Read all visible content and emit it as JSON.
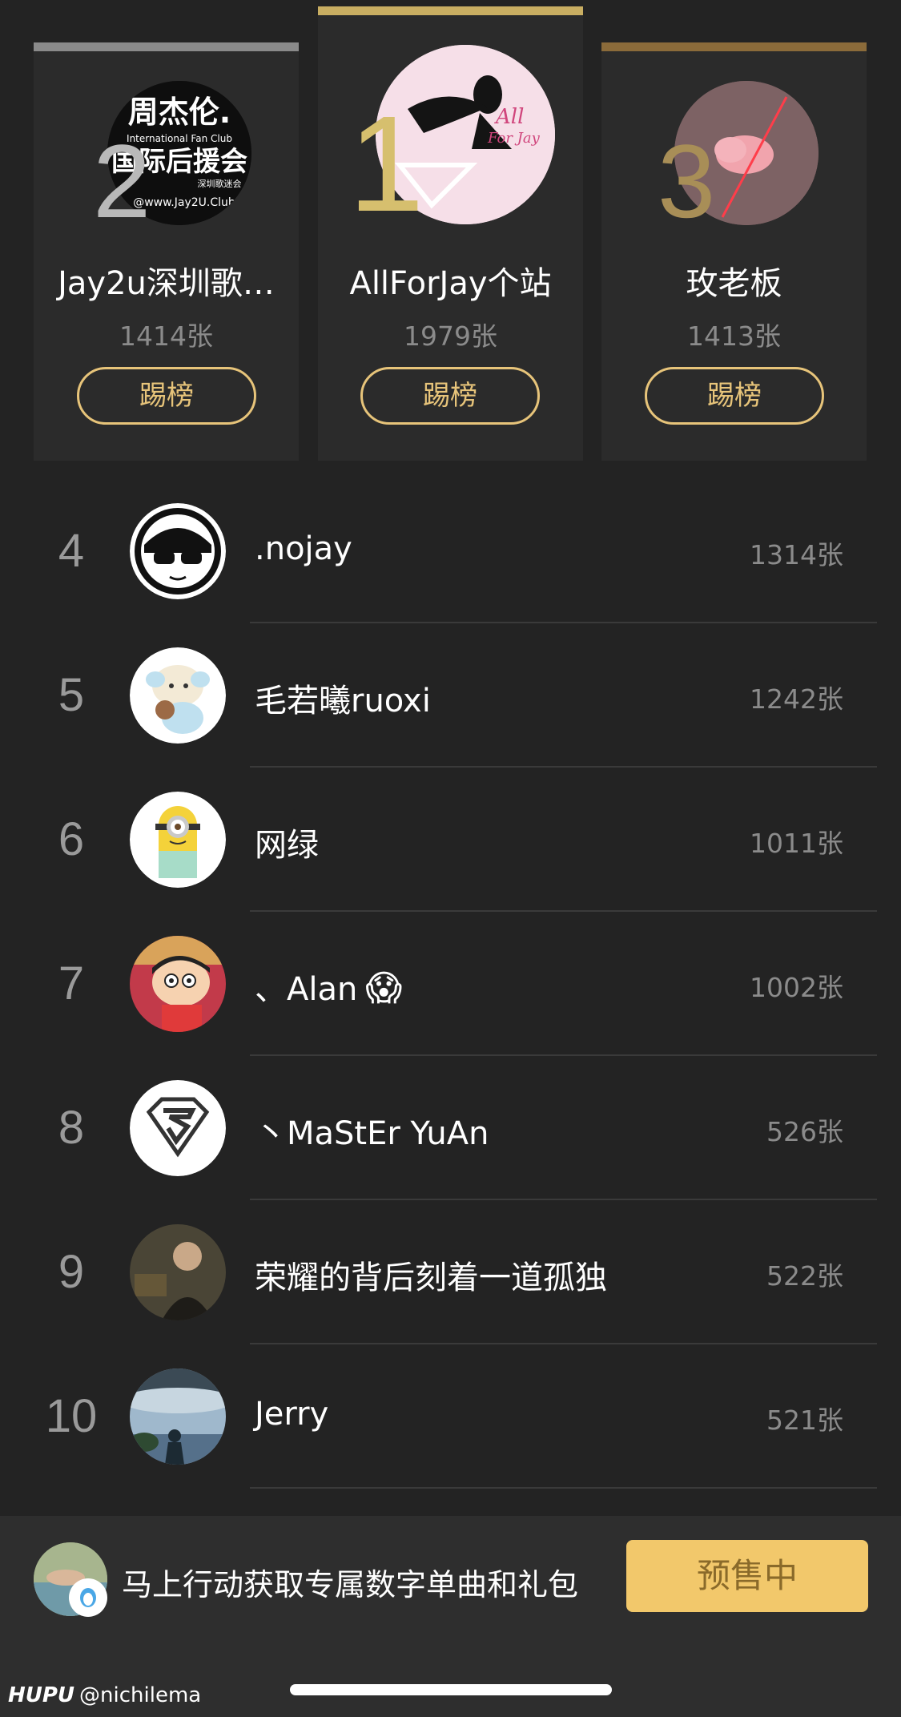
{
  "podium": [
    {
      "rank": "2",
      "name": "Jay2u深圳歌…",
      "count": "1414张",
      "button": "踢榜",
      "bar_color": "#8a8a8a"
    },
    {
      "rank": "1",
      "name": "AllForJay个站",
      "count": "1979张",
      "button": "踢榜",
      "bar_color": "#c9ae62"
    },
    {
      "rank": "3",
      "name": "玫老板",
      "count": "1413张",
      "button": "踢榜",
      "bar_color": "#8b6b3a"
    }
  ],
  "avatar_texts": {
    "jay2u_logo_line1": "周杰伦.",
    "jay2u_logo_line2": "International Fan Club",
    "jay2u_logo_line3": "国际后援会",
    "jay2u_logo_line4": "深圳歌迷会",
    "jay2u_logo_line5": "@www.Jay2U.Club",
    "allforjay_logo_line1": "All",
    "allforjay_logo_line2": "For Jay"
  },
  "ranking": [
    {
      "rank": "4",
      "name": ".nojay",
      "emoji": "",
      "count": "1314张"
    },
    {
      "rank": "5",
      "name": "毛若曦ruoxi",
      "emoji": "",
      "count": "1242张"
    },
    {
      "rank": "6",
      "name": "网绿",
      "emoji": "",
      "count": "1011张"
    },
    {
      "rank": "7",
      "name": "、Alan",
      "emoji": "😱",
      "count": "1002张"
    },
    {
      "rank": "8",
      "name": "丶MaStEr YuAn",
      "emoji": "",
      "count": "526张"
    },
    {
      "rank": "9",
      "name": "荣耀的背后刻着一道孤独",
      "emoji": "",
      "count": "522张"
    },
    {
      "rank": "10",
      "name": "Jerry",
      "emoji": "",
      "count": "521张"
    }
  ],
  "bottom_bar": {
    "promo_text": "马上行动获取专属数字单曲和礼包",
    "presale_label": "预售中",
    "button_color": "#f2c86b"
  },
  "watermark": {
    "logo": "HUPU",
    "handle": "@nichilema"
  },
  "colors": {
    "background": "#232323",
    "card": "#2b2b2b",
    "gold": "#e7c47a"
  }
}
